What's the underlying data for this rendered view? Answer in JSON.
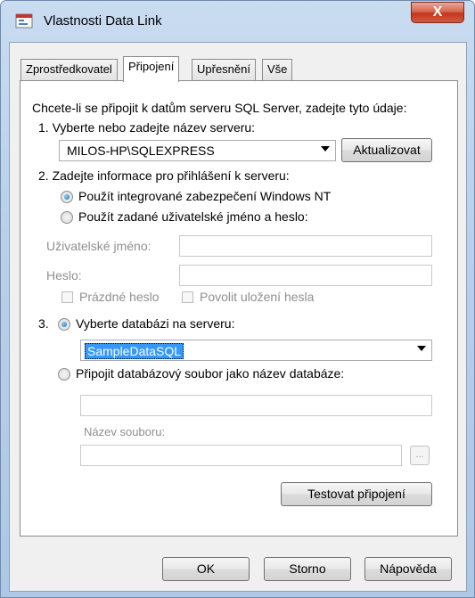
{
  "window": {
    "title": "Vlastnosti Data Link",
    "close_label": "X"
  },
  "tabs": [
    {
      "label": "Zprostředkovatel"
    },
    {
      "label": "Připojení"
    },
    {
      "label": "Upřesnění"
    },
    {
      "label": "Vše"
    }
  ],
  "connection": {
    "intro": "Chcete-li se připojit k datům serveru SQL Server, zadejte tyto údaje:",
    "step1_label": "1. Vyberte nebo zadejte název serveru:",
    "server_value": "MILOS-HP\\SQLEXPRESS",
    "refresh_label": "Aktualizovat",
    "step2_label": "2. Zadejte informace pro přihlášení k serveru:",
    "auth_integrated_label": "Použít integrované zabezpečení Windows NT",
    "auth_specific_label": "Použít zadané uživatelské jméno a heslo:",
    "username_label": "Uživatelské jméno:",
    "username_value": "",
    "password_label": "Heslo:",
    "password_value": "",
    "blank_password_label": "Prázdné heslo",
    "allow_save_label": "Povolit uložení hesla",
    "step3_prefix": "3.",
    "select_db_label": "Vyberte databázi na serveru:",
    "database_value": "SampleDataSQL",
    "attach_db_label": "Připojit databázový soubor jako název databáze:",
    "attach_db_name_value": "",
    "filename_label": "Název souboru:",
    "filename_value": "",
    "browse_label": "...",
    "test_label": "Testovat připojení"
  },
  "footer": {
    "ok_label": "OK",
    "cancel_label": "Storno",
    "help_label": "Nápověda"
  },
  "colors": {
    "accent": "#3399ff",
    "close": "#c2381e"
  },
  "icons": {
    "app": "data-link-icon",
    "close": "close-icon",
    "dropdown": "chevron-down-icon"
  }
}
